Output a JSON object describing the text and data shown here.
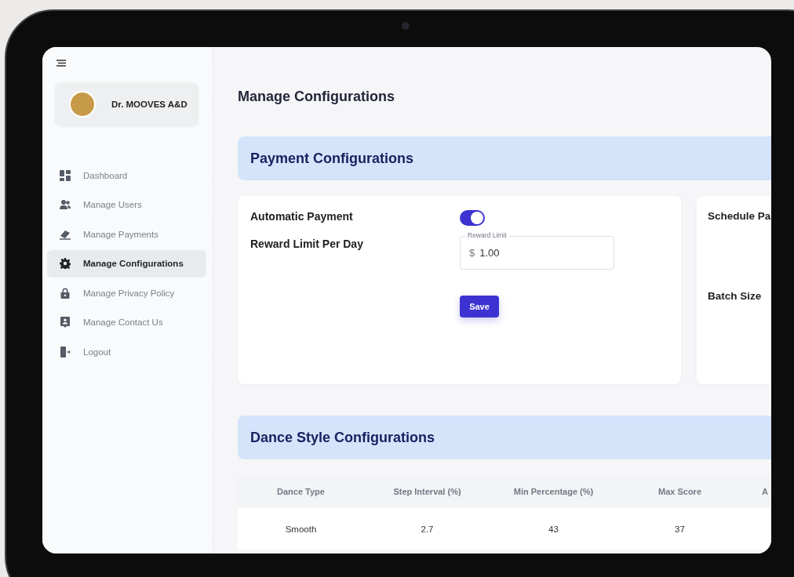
{
  "sidebar": {
    "profile": {
      "name": "Dr. MOOVES A&D"
    },
    "items": [
      {
        "label": "Dashboard",
        "kind": "dashboard",
        "selected": false
      },
      {
        "label": "Manage Users",
        "kind": "users",
        "selected": false
      },
      {
        "label": "Manage Payments",
        "kind": "payments",
        "selected": false
      },
      {
        "label": "Manage Configurations",
        "kind": "configurations",
        "selected": true
      },
      {
        "label": "Manage Privacy Policy",
        "kind": "privacy",
        "selected": false
      },
      {
        "label": "Manage Contact Us",
        "kind": "contact",
        "selected": false
      },
      {
        "label": "Logout",
        "kind": "logout",
        "selected": false
      }
    ]
  },
  "page_title": "Manage Configurations",
  "payment": {
    "title": "Payment Configurations",
    "automatic_payment": {
      "label": "Automatic Payment",
      "on": true
    },
    "reward_limit": {
      "label": "Reward Limit Per Day",
      "field_label": "Reward Limit",
      "prefix": "$",
      "value": "1.00"
    },
    "save_button": "Save",
    "schedule_label": "Schedule Pa",
    "batch_label": "Batch Size"
  },
  "dance": {
    "title": "Dance Style Configurations",
    "table": {
      "columns": [
        "Dance Type",
        "Step Interval (%)",
        "Min Percentage (%)",
        "Max Score",
        "A"
      ],
      "rows": [
        [
          "Smooth",
          "2.7",
          "43",
          "37"
        ]
      ]
    }
  }
}
